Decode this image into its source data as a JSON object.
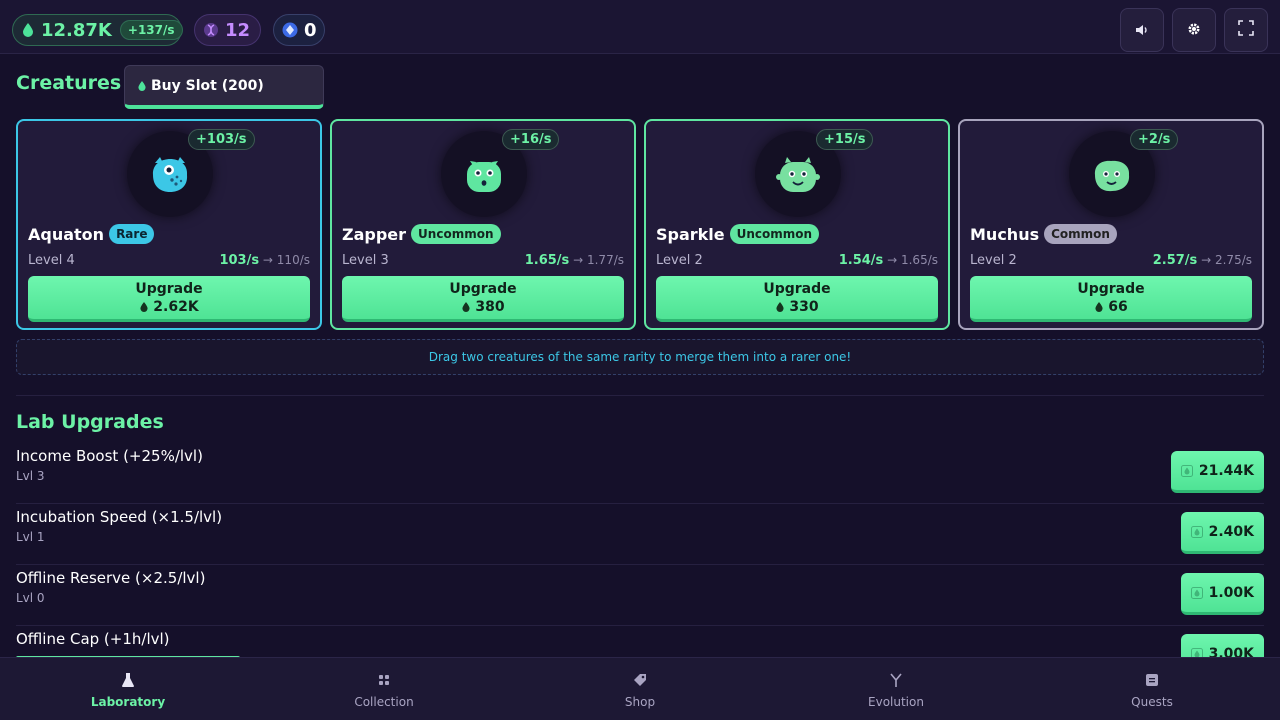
{
  "topbar": {
    "essence_value": "12.87K",
    "essence_rate": "+137/s",
    "dna_value": "12",
    "gem_value": "0",
    "icons": [
      "essence-drop-icon",
      "dna-icon",
      "gem-icon",
      "sound-icon",
      "gear-icon",
      "fullscreen-icon"
    ]
  },
  "creatures": {
    "title": "Creatures",
    "buy_slot_label": "Buy Slot (200)",
    "cards": [
      {
        "rate": "+103/s",
        "name": "Aquaton",
        "rarity": "Rare",
        "level": "Level 4",
        "income_current": "103/s",
        "income_next": "110/s",
        "upgrade_label": "Upgrade",
        "upgrade_cost": "2.62K",
        "color": "#3cc7e6"
      },
      {
        "rate": "+16/s",
        "name": "Zapper",
        "rarity": "Uncommon",
        "level": "Level 3",
        "income_current": "1.65/s",
        "income_next": "1.77/s",
        "upgrade_label": "Upgrade",
        "upgrade_cost": "380",
        "color": "#5fe6a0"
      },
      {
        "rate": "+15/s",
        "name": "Sparkle",
        "rarity": "Uncommon",
        "level": "Level 2",
        "income_current": "1.54/s",
        "income_next": "1.65/s",
        "upgrade_label": "Upgrade",
        "upgrade_cost": "330",
        "color": "#5fe6a0"
      },
      {
        "rate": "+2/s",
        "name": "Muchus",
        "rarity": "Common",
        "level": "Level 2",
        "income_current": "2.57/s",
        "income_next": "2.75/s",
        "upgrade_label": "Upgrade",
        "upgrade_cost": "66",
        "color": "#a8a4bd"
      }
    ],
    "hint": "Drag two creatures of the same rarity to merge them into a rarer one!"
  },
  "lab": {
    "title": "Lab Upgrades",
    "rows": [
      {
        "name": "Income Boost (+25%/lvl)",
        "level": "Lvl 3",
        "cost": "21.44K"
      },
      {
        "name": "Incubation Speed (×1.5/lvl)",
        "level": "Lvl 1",
        "cost": "2.40K"
      },
      {
        "name": "Offline Reserve (×2.5/lvl)",
        "level": "Lvl 0",
        "cost": "1.00K"
      },
      {
        "name": "Offline Cap (+1h/lvl)",
        "level": "",
        "cost": "3.00K"
      }
    ]
  },
  "nav": {
    "items": [
      {
        "label": "Laboratory",
        "icon": "flask-icon",
        "active": true
      },
      {
        "label": "Collection",
        "icon": "grid-icon",
        "active": false
      },
      {
        "label": "Shop",
        "icon": "tag-icon",
        "active": false
      },
      {
        "label": "Evolution",
        "icon": "branch-icon",
        "active": false
      },
      {
        "label": "Quests",
        "icon": "scroll-icon",
        "active": false
      }
    ]
  }
}
